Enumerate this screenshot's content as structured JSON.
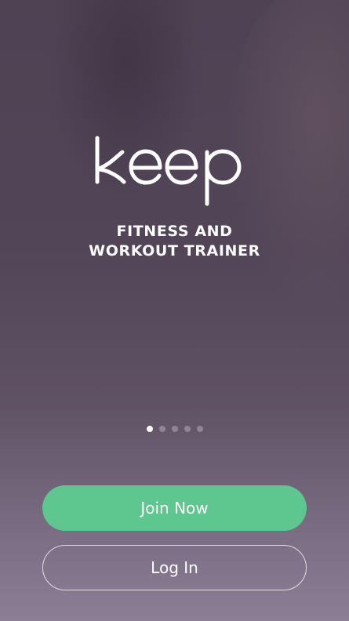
{
  "brand": {
    "logo_text": "keep"
  },
  "tagline": {
    "line1": "FITNESS AND",
    "line2": "WORKOUT TRAINER"
  },
  "pager": {
    "total": 5,
    "active_index": 0
  },
  "actions": {
    "join_label": "Join Now",
    "login_label": "Log In"
  },
  "colors": {
    "join_button": "#5ec78f",
    "background_top": "#4e4253",
    "background_bottom": "#8c7e94"
  }
}
